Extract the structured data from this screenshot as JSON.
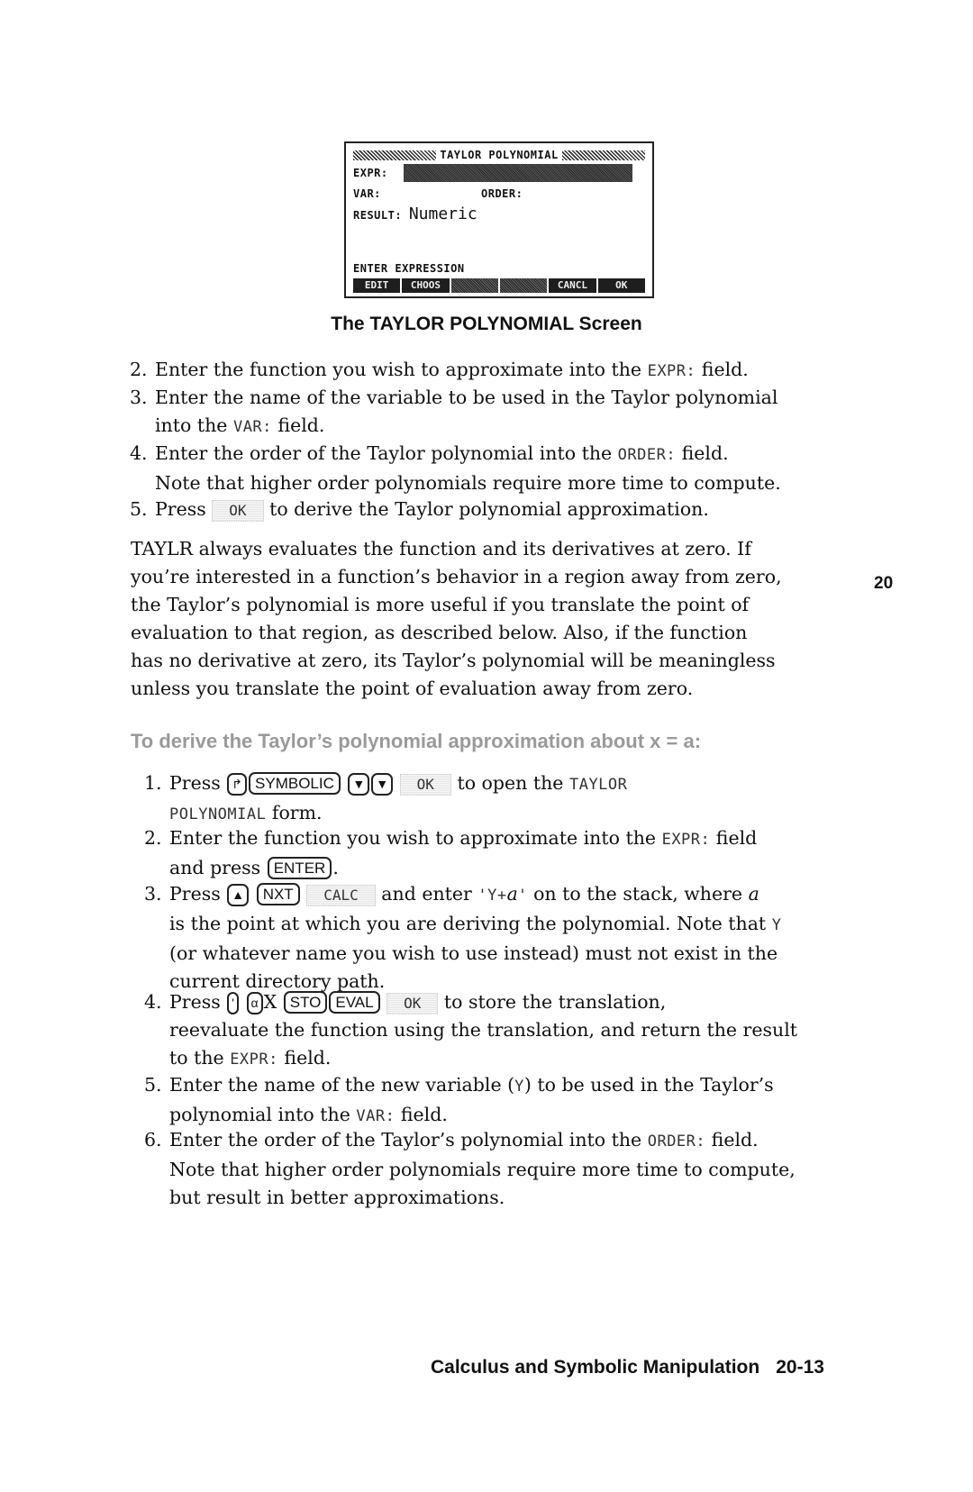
{
  "calculator_screen": {
    "title": "TAYLOR POLYNOMIAL",
    "fields": {
      "expr_label": "EXPR:",
      "var_label": "VAR:",
      "order_label": "ORDER:",
      "result_label": "RESULT:",
      "result_value": "Numeric"
    },
    "prompt": "ENTER EXPRESSION",
    "menu_keys": [
      "EDIT",
      "CHOOS",
      "",
      "",
      "CANCL",
      "OK"
    ]
  },
  "caption": "The TAYLOR POLYNOMIAL Screen",
  "steps_part1": [
    {
      "num": "2.",
      "pre": "Enter the function you wish to approximate into the ",
      "lcd": "EXPR:",
      "post": " field."
    },
    {
      "num": "3.",
      "line1": "Enter the name of the variable to be used in the Taylor polynomial",
      "pre": "into the ",
      "lcd": "VAR:",
      "post": " field."
    },
    {
      "num": "4.",
      "pre": "Enter the order of the Taylor polynomial into the ",
      "lcd": "ORDER:",
      "post": " field.",
      "line2": "Note that higher order polynomials require more time to compute."
    },
    {
      "num": "5.",
      "pre": "Press ",
      "softkey": "OK",
      "post": " to derive the Taylor polynomial approximation."
    }
  ],
  "paragraph": [
    "TAYLR always evaluates the function and its derivatives at zero. If",
    "you’re interested in a function’s behavior in a region away from zero,",
    "the Taylor’s polynomial is more useful if you translate the point of",
    "evaluation to that region, as described below. Also, if the function",
    "has no derivative at zero, its Taylor’s polynomial will be meaningless",
    "unless you translate the point of evaluation away from zero."
  ],
  "side_tab": "20",
  "section_heading": "To derive the Taylor’s polynomial approximation about x = a:",
  "steps_part2": {
    "s1": {
      "num": "1.",
      "press": "Press",
      "keys": [
        "↱",
        "SYMBOLIC",
        "▼",
        "▼"
      ],
      "softkey": "OK",
      "post": " to open the ",
      "lcd1": "TAYLOR",
      "lcd2": "POLYNOMIAL",
      "end": " form."
    },
    "s2": {
      "num": "2.",
      "pre": "Enter the function you wish to approximate into the ",
      "lcd": "EXPR:",
      "post": " field",
      "line2": "and press ",
      "key": "ENTER",
      "end": "."
    },
    "s3": {
      "num": "3.",
      "press": "Press",
      "keys": [
        "▲",
        "NXT"
      ],
      "softkey": "CALC",
      "mid": " and enter ",
      "quote_open": "'Y+",
      "var": "a",
      "quote_close": "'",
      "post": " on to the stack, where ",
      "var2": "a",
      "line2_pre": "is the point at which you are deriving the polynomial. Note that ",
      "lcd": "Y",
      "line3": "(or whatever name you wish to use instead) must not exist in the",
      "line4": "current directory path."
    },
    "s4": {
      "num": "4.",
      "press": "Press",
      "keys": [
        "'",
        "α"
      ],
      "x": "X",
      "keys2": [
        "STO",
        "EVAL"
      ],
      "softkey": "OK",
      "post": " to store the translation,",
      "line2": "reevaluate the function using the translation, and return the result",
      "line3_pre": "to the ",
      "lcd": "EXPR:",
      "line3_post": " field."
    },
    "s5": {
      "num": "5.",
      "pre": "Enter the name of the new variable (",
      "lcd": "Y",
      "post": ") to be used in the Taylor’s",
      "line2_pre": "polynomial into the ",
      "lcd2": "VAR:",
      "line2_post": " field."
    },
    "s6": {
      "num": "6.",
      "pre": "Enter the order of the Taylor’s polynomial into the ",
      "lcd": "ORDER:",
      "post": " field.",
      "line2": "Note that higher order polynomials require more time to compute,",
      "line3": "but result in better approximations."
    }
  },
  "footer": {
    "title": "Calculus and Symbolic Manipulation",
    "page": "20-13"
  }
}
